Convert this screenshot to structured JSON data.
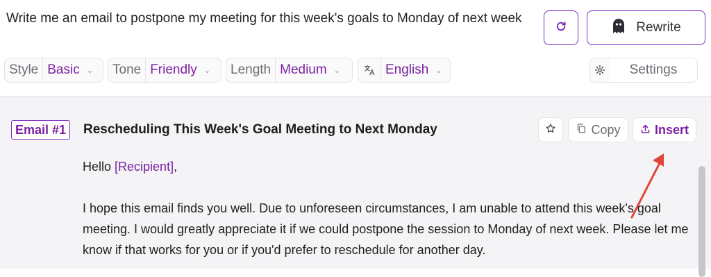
{
  "composer": {
    "prompt": "Write me an email to postpone my meeting for this week's goals to Monday of next week",
    "refresh_icon": "refresh-icon",
    "rewrite_label": "Rewrite",
    "rewrite_icon": "ghost-icon"
  },
  "options": {
    "style": {
      "label": "Style",
      "value": "Basic"
    },
    "tone": {
      "label": "Tone",
      "value": "Friendly"
    },
    "length": {
      "label": "Length",
      "value": "Medium"
    },
    "language": {
      "icon": "translate-icon",
      "value": "English"
    }
  },
  "settings": {
    "label": "Settings",
    "icon": "gear-icon"
  },
  "result": {
    "tag": "Email #1",
    "subject": "Rescheduling This Week's Goal Meeting to Next Monday",
    "actions": {
      "copy": "Copy",
      "insert": "Insert"
    },
    "greeting_prefix": "Hello ",
    "recipient": "[Recipient]",
    "greeting_suffix": ",",
    "paragraph": "I hope this email finds you well. Due to unforeseen circumstances, I am unable to attend this week's goal meeting. I would greatly appreciate it if we could postpone the session to Monday of next week. Please let me know if that works for you or if you'd prefer to reschedule for another day."
  },
  "colors": {
    "accent": "#7b1fa2",
    "annotation_arrow": "#e0453a",
    "panel_bg": "#f4f4f7"
  }
}
